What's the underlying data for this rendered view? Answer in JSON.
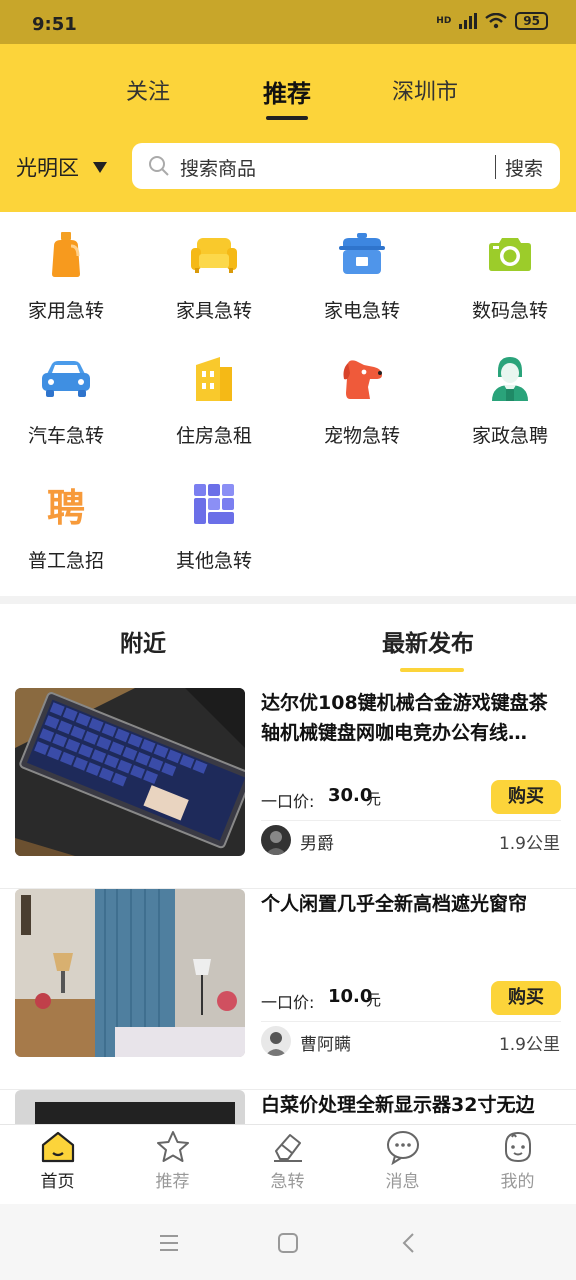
{
  "status": {
    "time": "9:51",
    "network": "HD",
    "battery": "95"
  },
  "header": {
    "tabs": [
      {
        "label": "关注"
      },
      {
        "label": "推荐"
      },
      {
        "label": "深圳市"
      }
    ],
    "location": "光明区",
    "search": {
      "placeholder": "搜索商品",
      "button": "搜索"
    }
  },
  "categories": [
    {
      "label": "家用急转",
      "icon": "bottle-icon"
    },
    {
      "label": "家具急转",
      "icon": "sofa-icon"
    },
    {
      "label": "家电急转",
      "icon": "rice-cooker-icon"
    },
    {
      "label": "数码急转",
      "icon": "camera-icon"
    },
    {
      "label": "汽车急转",
      "icon": "car-icon"
    },
    {
      "label": "住房急租",
      "icon": "building-icon"
    },
    {
      "label": "宠物急转",
      "icon": "dog-icon"
    },
    {
      "label": "家政急聘",
      "icon": "housekeeper-icon"
    },
    {
      "label": "普工急招",
      "icon": "hire-icon",
      "glyph": "聘"
    },
    {
      "label": "其他急转",
      "icon": "grid-icon"
    }
  ],
  "feed": {
    "tabs": [
      {
        "label": "附近"
      },
      {
        "label": "最新发布"
      }
    ],
    "items": [
      {
        "title": "达尔优108键机械合金游戏键盘茶轴机械键盘网咖电竞办公有线…",
        "price_label": "一口价:",
        "price": "30.0",
        "unit": "元",
        "buy": "购买",
        "user": "男爵",
        "distance": "1.9公里"
      },
      {
        "title": "个人闲置几乎全新高档遮光窗帘",
        "price_label": "一口价:",
        "price": "10.0",
        "unit": "元",
        "buy": "购买",
        "user": "曹阿瞒",
        "distance": "1.9公里"
      },
      {
        "title": "白菜价处理全新显示器32寸无边",
        "price_label": "",
        "price": "",
        "unit": "",
        "buy": "",
        "user": "",
        "distance": ""
      }
    ]
  },
  "bottom_nav": [
    {
      "label": "首页",
      "icon": "home-icon"
    },
    {
      "label": "推荐",
      "icon": "star-icon"
    },
    {
      "label": "急转",
      "icon": "eraser-icon"
    },
    {
      "label": "消息",
      "icon": "chat-icon"
    },
    {
      "label": "我的",
      "icon": "profile-icon"
    }
  ],
  "colors": {
    "brand_yellow": "#fcd43a",
    "status_bar": "#c8a62a"
  }
}
